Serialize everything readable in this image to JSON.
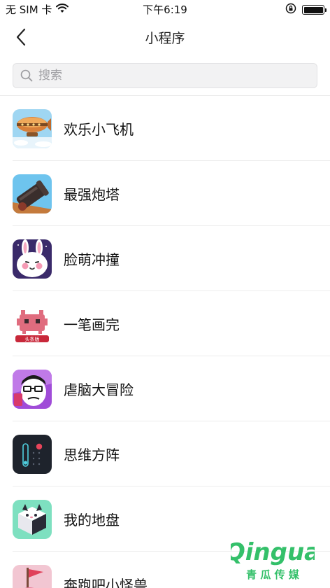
{
  "status_bar": {
    "carrier": "无 SIM 卡",
    "time": "下午6:19"
  },
  "nav": {
    "title": "小程序"
  },
  "search": {
    "placeholder": "搜索"
  },
  "apps": [
    {
      "name": "欢乐小飞机",
      "icon": "airship-icon"
    },
    {
      "name": "最强炮塔",
      "icon": "cannon-icon"
    },
    {
      "name": "脸萌冲撞",
      "icon": "bunny-face-icon"
    },
    {
      "name": "一笔画完",
      "icon": "pink-monster-icon",
      "icon_badge": "头条版"
    },
    {
      "name": "虐脑大冒险",
      "icon": "cartoon-character-icon"
    },
    {
      "name": "思维方阵",
      "icon": "dots-grid-icon"
    },
    {
      "name": "我的地盘",
      "icon": "cube-cat-icon"
    },
    {
      "name": "奔跑吧小怪兽",
      "icon": "running-monster-icon"
    }
  ],
  "watermark": {
    "brand": "Qingua",
    "subtitle": "青 瓜 传 媒",
    "color": "#34c06a"
  }
}
